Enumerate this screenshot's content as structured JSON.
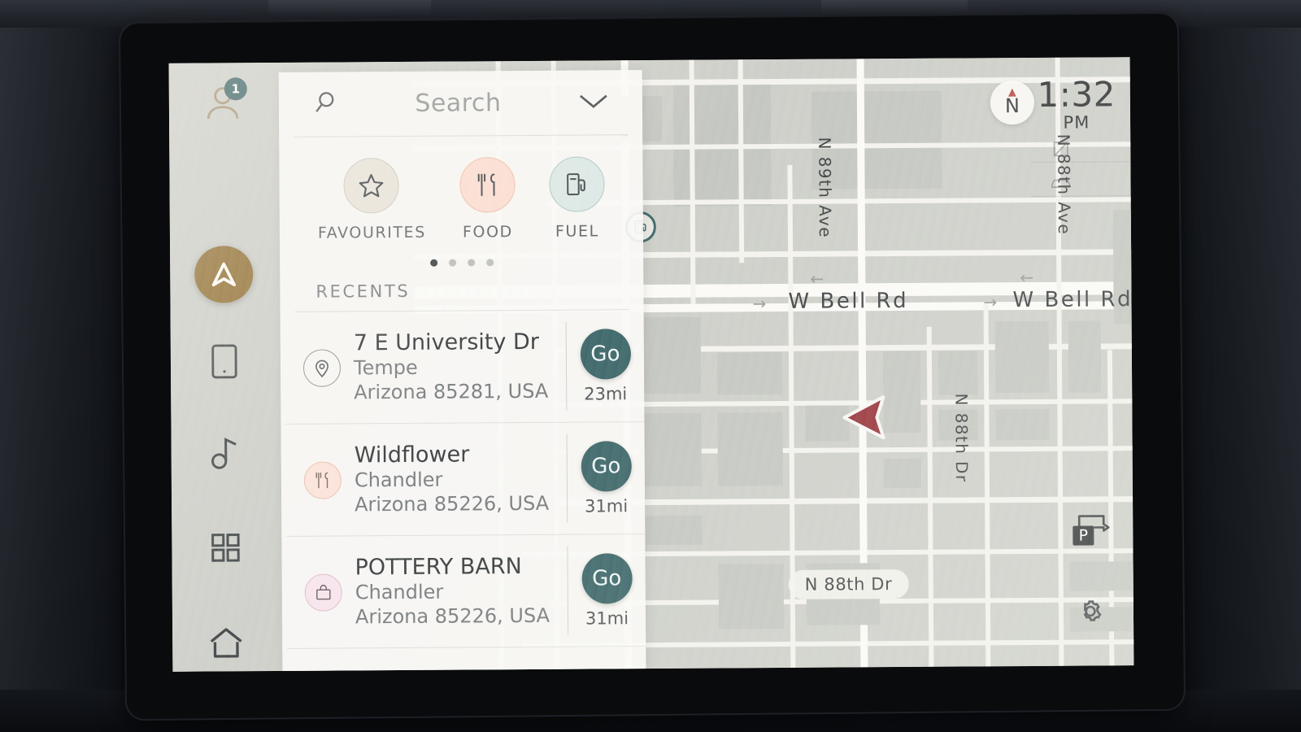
{
  "device": {
    "type": "car-infotainment-head-unit"
  },
  "statusbar": {
    "time": "1:32",
    "ampm": "PM",
    "compass_letter": "N"
  },
  "rail": {
    "items": [
      {
        "name": "profile",
        "icon": "profile-icon",
        "badge": "1",
        "active": false
      },
      {
        "name": "navigation",
        "icon": "navigation-arrow-icon",
        "active": true
      },
      {
        "name": "phone",
        "icon": "phone-icon",
        "active": false
      },
      {
        "name": "media",
        "icon": "music-note-icon",
        "active": false
      },
      {
        "name": "apps",
        "icon": "apps-grid-icon",
        "active": false
      },
      {
        "name": "home",
        "icon": "home-icon",
        "active": false
      }
    ]
  },
  "panel": {
    "search": {
      "placeholder": "Search",
      "icon": "search-icon",
      "collapse_icon": "chevron-down-icon"
    },
    "shortcuts": [
      {
        "label": "FAVOURITES",
        "icon": "star-icon"
      },
      {
        "label": "FOOD",
        "icon": "cutlery-icon"
      },
      {
        "label": "FUEL",
        "icon": "fuel-pump-icon"
      }
    ],
    "pagination": {
      "count": 4,
      "active_index": 0
    },
    "recents_header": "RECENTS",
    "recents": [
      {
        "title": "7 E University Dr",
        "city": "Tempe",
        "region": "Arizona 85281, USA",
        "go_label": "Go",
        "distance": "23mi",
        "icon": "map-pin-icon"
      },
      {
        "title": "Wildflower",
        "city": "Chandler",
        "region": "Arizona 85226, USA",
        "go_label": "Go",
        "distance": "31mi",
        "icon": "cutlery-icon"
      },
      {
        "title": "POTTERY BARN",
        "city": "Chandler",
        "region": "Arizona 85226, USA",
        "go_label": "Go",
        "distance": "31mi",
        "icon": "shopping-bag-icon"
      }
    ]
  },
  "map": {
    "labels": [
      {
        "text": "N 89th Ave",
        "orientation": "vertical"
      },
      {
        "text": "N 88th Ave",
        "orientation": "vertical"
      },
      {
        "text": "N 88th Dr",
        "orientation": "vertical"
      },
      {
        "text": "W Bell Rd",
        "orientation": "horizontal"
      },
      {
        "text": "W Bell Rd",
        "orientation": "horizontal"
      }
    ],
    "label_n89ave": "N 89th Ave",
    "label_n88ave": "N 88th Ave",
    "label_n88dr": "N 88th Dr",
    "label_bell_left": "W Bell Rd",
    "label_bell_right": "W Bell Rd",
    "chip_n88dr": "N 88th Dr",
    "poi": [
      {
        "type": "fuel-station",
        "icon": "fuel-pump-icon"
      }
    ],
    "vehicle": {
      "icon": "vehicle-arrow-icon",
      "heading": "west"
    },
    "controls": {
      "parking": "parking-route-icon",
      "settings": "gear-icon",
      "widget_1": "map-layer-icon",
      "widget_2": "car-view-icon"
    }
  },
  "colors": {
    "accent_teal": "#2d595c",
    "accent_bronze": "#8a6526",
    "vehicle_red": "#8e1f28",
    "map_land": "#c9cac4",
    "map_road": "#f2f1ec",
    "panel_bg": "#faf9f5"
  }
}
